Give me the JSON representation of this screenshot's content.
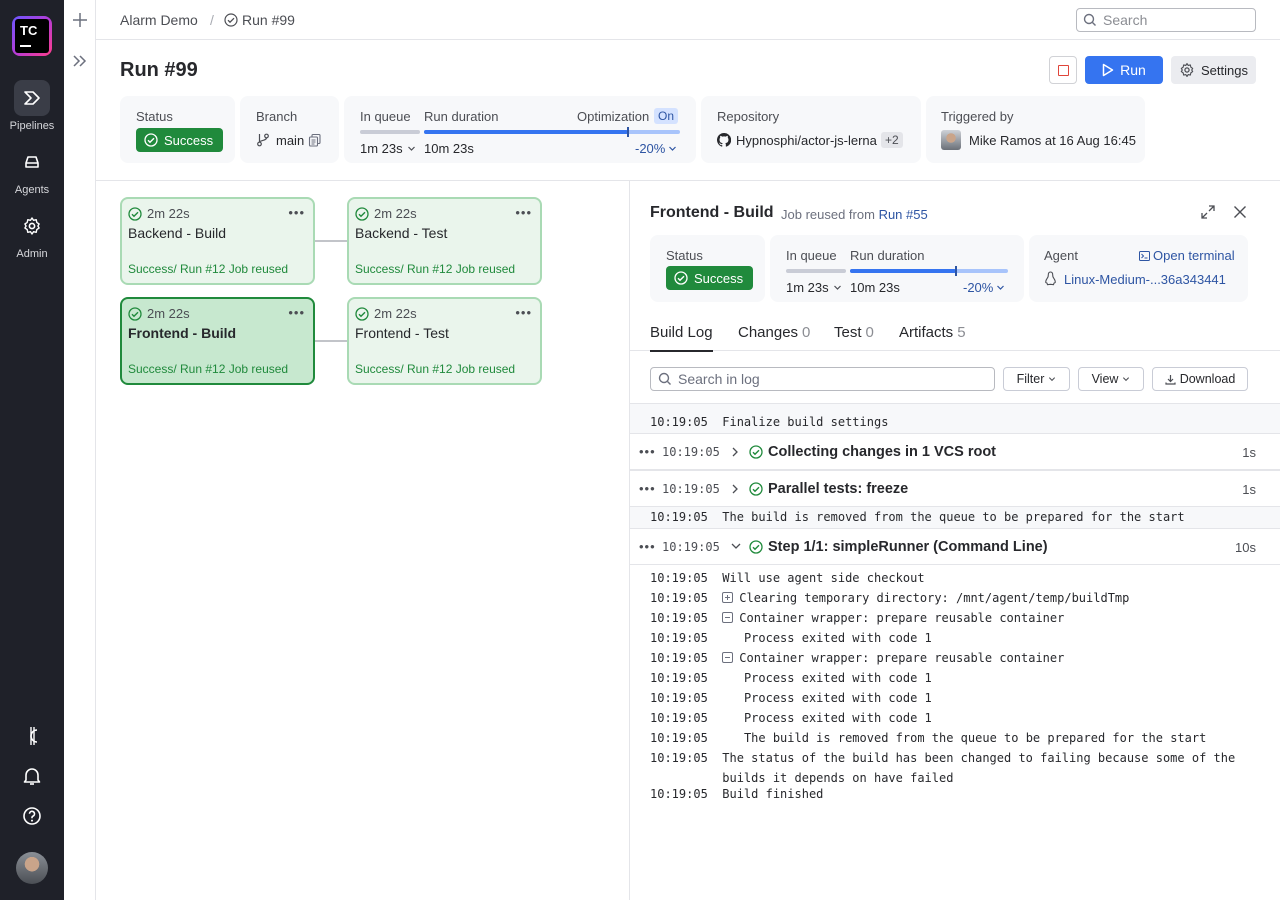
{
  "nav": {
    "logo_text": "TC",
    "items": [
      {
        "label": "Pipelines",
        "icon": "pipelines-icon",
        "active": true
      },
      {
        "label": "Agents",
        "icon": "agents-icon",
        "active": false
      },
      {
        "label": "Admin",
        "icon": "gear-icon",
        "active": false
      }
    ]
  },
  "topbar": {
    "breadcrumb_project": "Alarm Demo",
    "breadcrumb_sep": "/",
    "breadcrumb_run": "Run #99",
    "search_placeholder": "Search"
  },
  "header": {
    "title": "Run #99",
    "run_label": "Run",
    "settings_label": "Settings"
  },
  "summary": {
    "status_label": "Status",
    "status_value": "Success",
    "branch_label": "Branch",
    "branch_value": "main",
    "in_queue_label": "In queue",
    "in_queue_value": "1m 23s",
    "run_duration_label": "Run duration",
    "run_duration_value": "10m 23s",
    "optimization_label": "Optimization",
    "optimization_state": "On",
    "optimization_delta": "-20%",
    "repository_label": "Repository",
    "repository_value": "Hypnosphi/actor-js-lerna",
    "repository_extra": "+2",
    "triggered_label": "Triggered by",
    "triggered_value": "Mike Ramos at 16 Aug 16:45"
  },
  "jobs": [
    {
      "time": "2m 22s",
      "name": "Backend - Build",
      "status": "Success/ Run #12 Job reused"
    },
    {
      "time": "2m 22s",
      "name": "Backend - Test",
      "status": "Success/ Run #12 Job reused"
    },
    {
      "time": "2m 22s",
      "name": "Frontend - Build",
      "status": "Success/ Run #12 Job reused"
    },
    {
      "time": "2m 22s",
      "name": "Frontend - Test",
      "status": "Success/ Run #12 Job reused"
    }
  ],
  "panel": {
    "title": "Frontend - Build",
    "subtitle_prefix": "Job reused from",
    "subtitle_link": "Run #55",
    "status_label": "Status",
    "status_value": "Success",
    "in_queue_label": "In queue",
    "in_queue_value": "1m 23s",
    "run_duration_label": "Run duration",
    "run_duration_value": "10m 23s",
    "delta": "-20%",
    "agent_label": "Agent",
    "open_terminal": "Open terminal",
    "agent_value": "Linux-Medium-...36a343441",
    "tabs": [
      {
        "label": "Build Log",
        "count": ""
      },
      {
        "label": "Changes",
        "count": "0"
      },
      {
        "label": "Test",
        "count": "0"
      },
      {
        "label": "Artifacts",
        "count": "5"
      }
    ],
    "log_search_placeholder": "Search in log",
    "filter_label": "Filter",
    "view_label": "View",
    "download_label": "Download"
  },
  "log": {
    "lines_top": [
      {
        "ts": "10:19:05",
        "text": "Finalize build settings"
      }
    ],
    "steps": [
      {
        "ts": "10:19:05",
        "name": "Collecting changes in 1 VCS root",
        "dur": "1s"
      },
      {
        "ts": "10:19:05",
        "name": "Parallel tests: freeze",
        "dur": "1s"
      },
      {
        "ts": "10:19:05",
        "name": "Step 1/1: simpleRunner (Command Line)",
        "dur": "10s"
      }
    ],
    "line_mid": {
      "ts": "10:19:05",
      "text": "The build is removed from the queue to be prepared for the start"
    },
    "lines_bottom": [
      {
        "ts": "10:19:05",
        "text": "Will use agent side checkout",
        "tree": ""
      },
      {
        "ts": "10:19:05",
        "text": "Clearing temporary directory: /mnt/agent/temp/buildTmp",
        "tree": "plus"
      },
      {
        "ts": "10:19:05",
        "text": "Container wrapper: prepare reusable container",
        "tree": "minus"
      },
      {
        "ts": "10:19:05",
        "text": "Process exited with code 1",
        "tree": "indent"
      },
      {
        "ts": "10:19:05",
        "text": "Container wrapper: prepare reusable container",
        "tree": "minus"
      },
      {
        "ts": "10:19:05",
        "text": "Process exited with code 1",
        "tree": "indent"
      },
      {
        "ts": "10:19:05",
        "text": "Process exited with code 1",
        "tree": "indent"
      },
      {
        "ts": "10:19:05",
        "text": "Process exited with code 1",
        "tree": "indent"
      },
      {
        "ts": "10:19:05",
        "text": "The build is removed from the queue to be prepared for the start",
        "tree": "indent"
      },
      {
        "ts": "10:19:05",
        "text": "The status of the build has been changed to failing because some of the",
        "tree": ""
      },
      {
        "ts": "",
        "text": "builds it depends on have failed",
        "tree": ""
      },
      {
        "ts": "10:19:05",
        "text": "Build finished",
        "tree": ""
      }
    ]
  },
  "colors": {
    "accent": "#3574f0",
    "success": "#208a3c",
    "nav_bg": "#1f2129"
  }
}
